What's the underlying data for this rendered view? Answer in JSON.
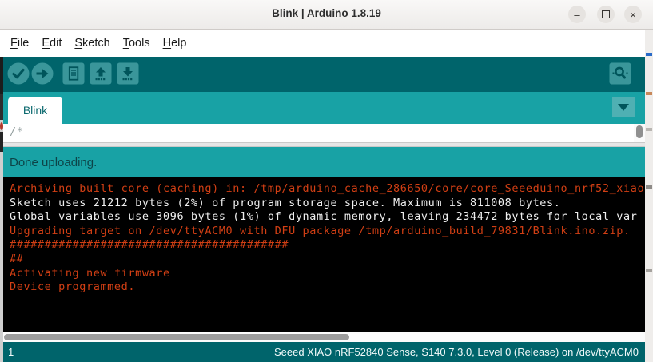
{
  "window": {
    "title": "Blink | Arduino 1.8.19",
    "controls": {
      "minimize_glyph": "–",
      "close_glyph": "×"
    }
  },
  "menu": {
    "items": [
      {
        "first": "F",
        "rest": "ile"
      },
      {
        "first": "E",
        "rest": "dit"
      },
      {
        "first": "S",
        "rest": "ketch"
      },
      {
        "first": "T",
        "rest": "ools"
      },
      {
        "first": "H",
        "rest": "elp"
      }
    ]
  },
  "toolbar": {
    "buttons": [
      {
        "icon": "verify-check-icon",
        "action": "Verify"
      },
      {
        "icon": "upload-arrow-icon",
        "action": "Upload"
      },
      {
        "icon": "new-sketch-icon",
        "action": "New"
      },
      {
        "icon": "open-sketch-icon",
        "action": "Open"
      },
      {
        "icon": "save-sketch-icon",
        "action": "Save"
      }
    ],
    "serial_monitor": {
      "icon": "serial-monitor-magnifier-icon"
    }
  },
  "tabs": {
    "active_label": "Blink",
    "menu_icon": "chevron-down-icon"
  },
  "editor": {
    "visible_code": "/*"
  },
  "status": {
    "message": "Done uploading."
  },
  "console": {
    "lines": [
      {
        "type": "error",
        "text": "Archiving built core (caching) in: /tmp/arduino_cache_286650/core/core_Seeeduino_nrf52_xiao"
      },
      {
        "type": "info",
        "text": "Sketch uses 21212 bytes (2%) of program storage space. Maximum is 811008 bytes."
      },
      {
        "type": "info",
        "text": "Global variables use 3096 bytes (1%) of dynamic memory, leaving 234472 bytes for local var"
      },
      {
        "type": "error",
        "text": "Upgrading target on /dev/ttyACM0 with DFU package /tmp/arduino_build_79831/Blink.ino.zip. "
      },
      {
        "type": "error",
        "text": "########################################"
      },
      {
        "type": "error",
        "text": "##"
      },
      {
        "type": "error",
        "text": "Activating new firmware"
      },
      {
        "type": "error",
        "text": "Device programmed."
      }
    ]
  },
  "footer": {
    "line_number": "1",
    "board_info": "Seeed XIAO nRF52840 Sense, S140 7.3.0, Level 0 (Release) on /dev/ttyACM0"
  },
  "colors": {
    "teal_dark": "#00646b",
    "teal_light": "#18a2a5",
    "toolbar_button_fill": "#3a969a",
    "console_error": "#d23f14",
    "console_info": "#efefef",
    "status_text": "#0d4448"
  }
}
